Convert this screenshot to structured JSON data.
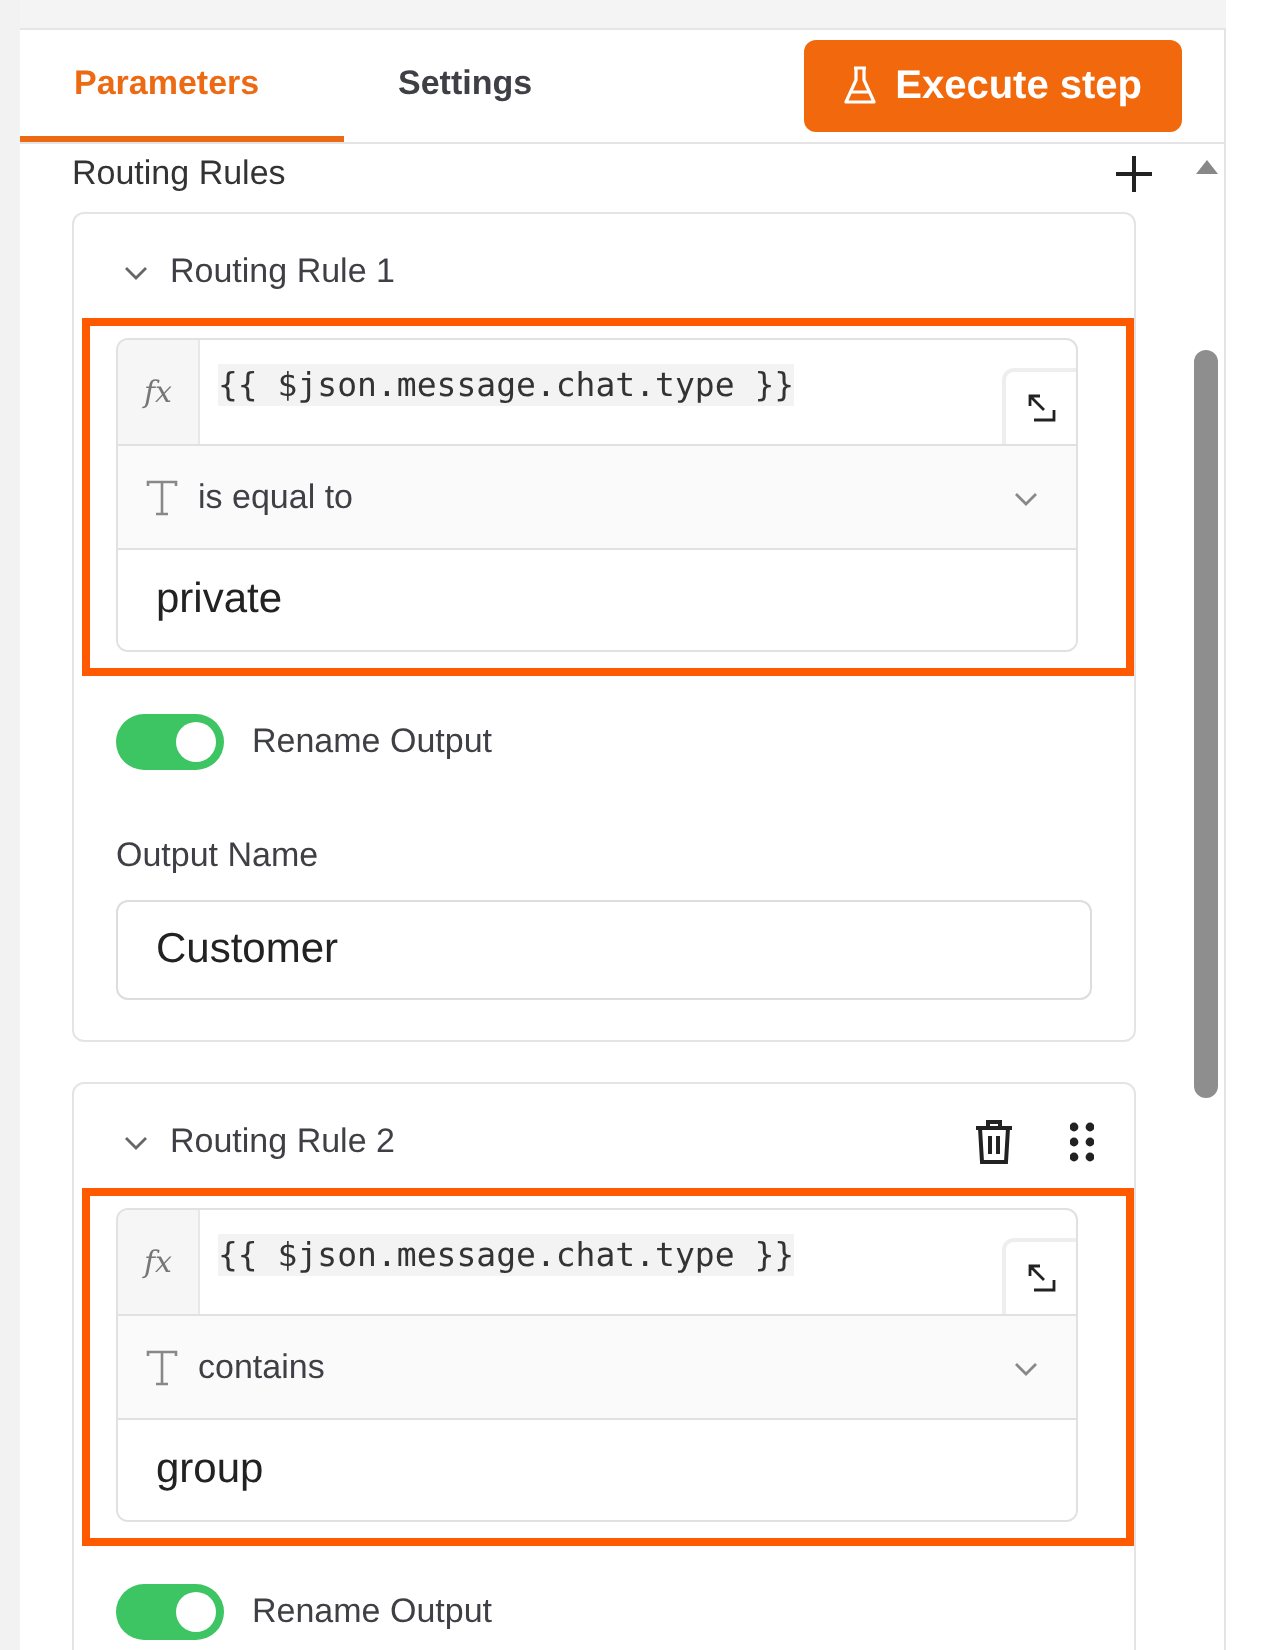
{
  "tabs": [
    {
      "label": "Parameters",
      "selected": true
    },
    {
      "label": "Settings",
      "selected": false
    }
  ],
  "execute_button": {
    "label": "Execute step"
  },
  "section": {
    "title": "Routing Rules"
  },
  "rules": [
    {
      "title": "Routing Rule 1",
      "expanded": true,
      "actions_visible": false,
      "highlighted": true,
      "condition": {
        "mode": "fx",
        "left": "{{ $json.message.chat.type }}",
        "operator": "is equal to",
        "value": "private"
      },
      "rename_output": {
        "label": "Rename Output",
        "on": true
      },
      "output_name": {
        "label": "Output Name",
        "value": "Customer"
      }
    },
    {
      "title": "Routing Rule 2",
      "expanded": true,
      "actions_visible": true,
      "highlighted": true,
      "condition": {
        "mode": "fx",
        "left": "{{ $json.message.chat.type }}",
        "operator": "contains",
        "value": "group"
      },
      "rename_output": {
        "label": "Rename Output",
        "on": true
      }
    }
  ]
}
